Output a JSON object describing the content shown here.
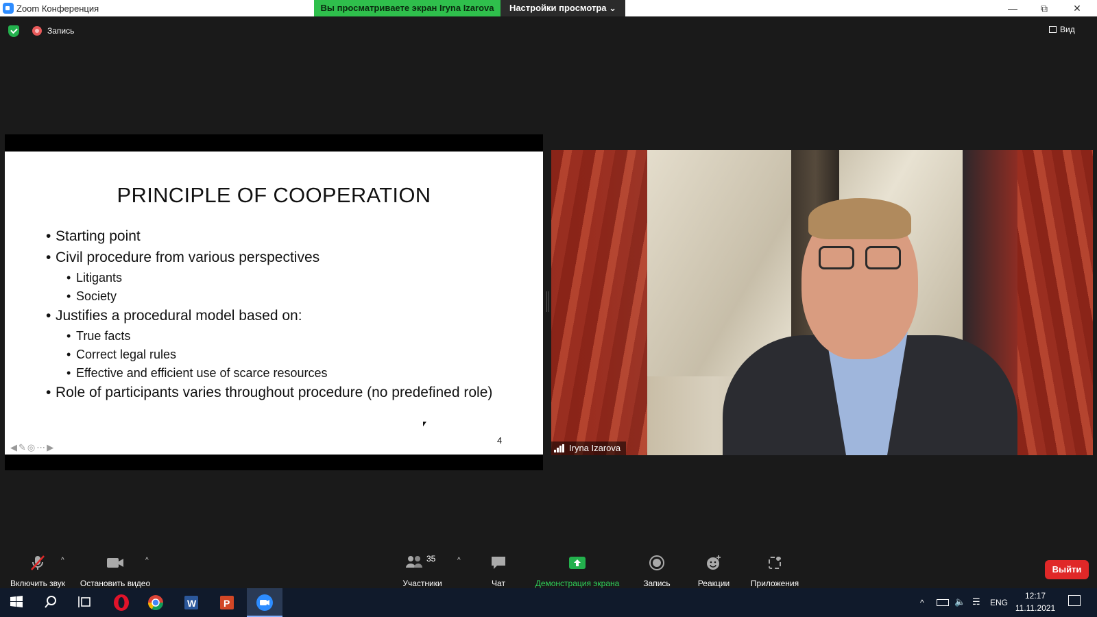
{
  "window": {
    "title": "Zoom Конференция",
    "share_banner": "Вы просматриваете экран Iryna Izarova",
    "view_settings": "Настройки просмотра ⌄"
  },
  "meeting_bar": {
    "record_label": "Запись",
    "view_label": "Вид"
  },
  "slide": {
    "title": "PRINCIPLE OF COOPERATION",
    "bullets": [
      {
        "level": 1,
        "text": "Starting point"
      },
      {
        "level": 1,
        "text": "Civil procedure from various perspectives"
      },
      {
        "level": 2,
        "text": "Litigants"
      },
      {
        "level": 2,
        "text": "Society"
      },
      {
        "level": 1,
        "text": "Justifies a procedural model based on:"
      },
      {
        "level": 2,
        "text": "True facts"
      },
      {
        "level": 2,
        "text": "Correct legal rules"
      },
      {
        "level": 2,
        "text": "Effective and efficient use of scarce resources"
      },
      {
        "level": 1,
        "text": "Role of participants varies throughout procedure (no predefined role)"
      }
    ],
    "page_number": "4"
  },
  "video": {
    "participant_name": "Iryna Izarova"
  },
  "toolbar": {
    "unmute": "Включить звук",
    "stop_video": "Остановить видео",
    "participants": "Участники",
    "participants_count": "35",
    "chat": "Чат",
    "share_screen": "Демонстрация экрана",
    "record": "Запись",
    "reactions": "Реакции",
    "apps": "Приложения",
    "leave": "Выйти"
  },
  "taskbar": {
    "language": "ENG",
    "time": "12:17",
    "date": "11.11.2021"
  },
  "colors": {
    "share_banner_green": "#2fbf4c",
    "leave_red": "#e02828",
    "share_button_green": "#23b14d",
    "zoom_blue": "#2d8cff"
  }
}
